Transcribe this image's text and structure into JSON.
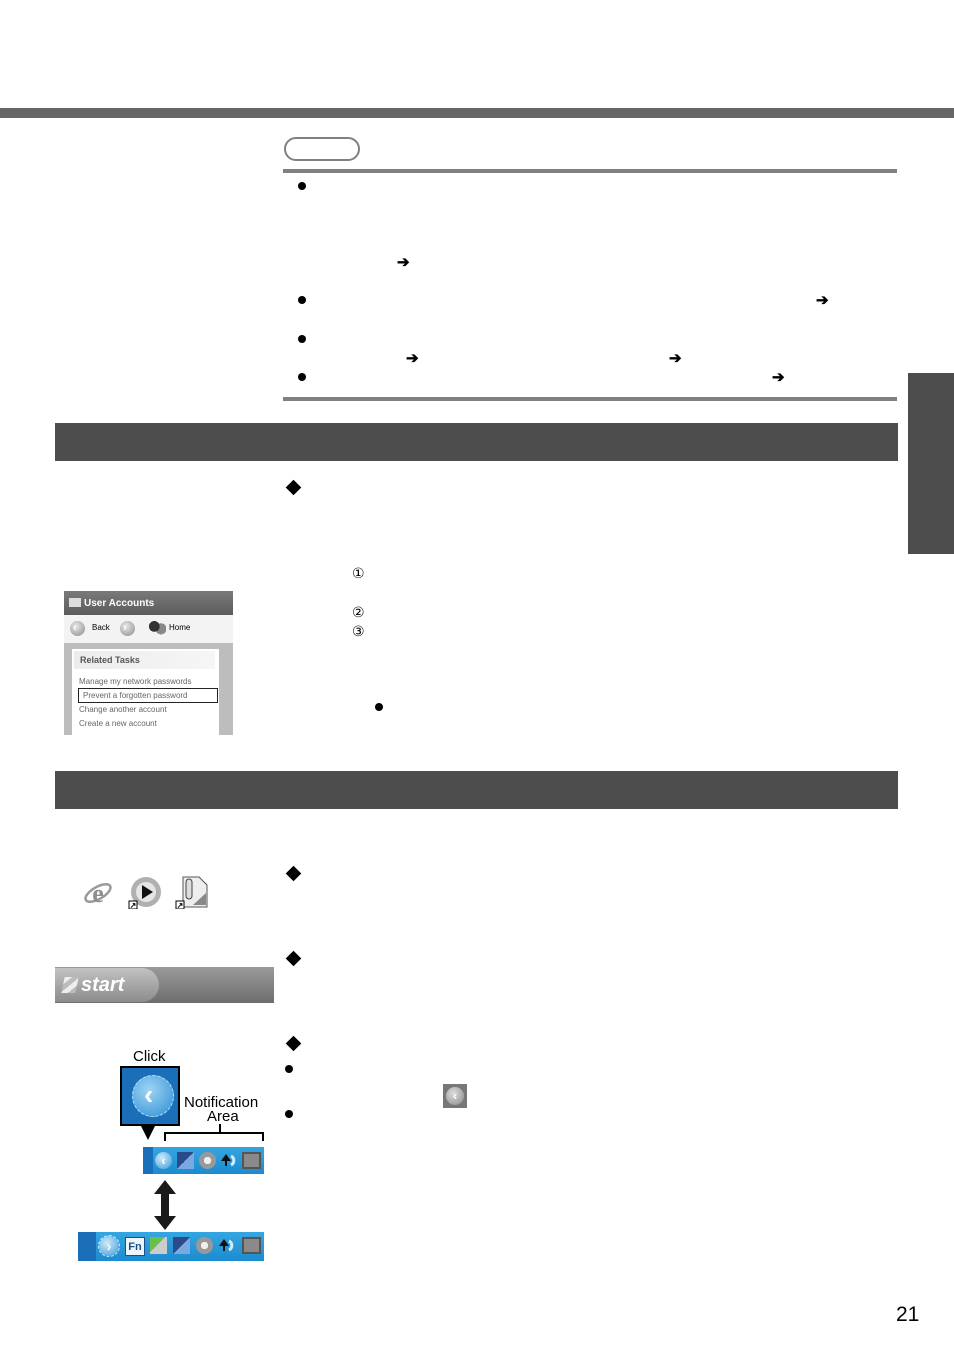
{
  "page": {
    "page_number": "21",
    "colors": {
      "header_rule": "#666666",
      "section_bar": "#4d4d4d",
      "note_rule": "#808080",
      "side_tab": "#4d4d4d",
      "tray_blue": "#1c8bd0"
    }
  },
  "note": {
    "label_icon": "note-pill",
    "bullets": [
      {
        "symbol": "●",
        "arrows": [
          "➔"
        ]
      },
      {
        "symbol": "●",
        "arrows": [
          "➔"
        ]
      },
      {
        "symbol": "●",
        "arrows": [
          "➔",
          "➔"
        ]
      },
      {
        "symbol": "●",
        "arrows": [
          "➔"
        ]
      }
    ]
  },
  "section1": {
    "diamond": "◆",
    "steps": [
      "①",
      "②",
      "③"
    ],
    "bullet": "●",
    "user_accounts": {
      "title": "User Accounts",
      "back_label": "Back",
      "forward_icon": "forward-arrow-icon",
      "home_label": "Home",
      "related_tasks_heading": "Related Tasks",
      "tasks": [
        {
          "label": "Manage my network passwords",
          "selected": false
        },
        {
          "label": "Prevent a forgotten password",
          "selected": true
        },
        {
          "label": "Change another account",
          "selected": false
        },
        {
          "label": "Create a new account",
          "selected": false
        }
      ]
    }
  },
  "section2": {
    "diamonds": [
      "◆",
      "◆",
      "◆"
    ],
    "bullets": [
      "●",
      "●"
    ],
    "desktop_icons": [
      "internet-explorer-icon",
      "media-player-shortcut-icon",
      "volume-document-shortcut-icon"
    ],
    "start_button_label": "start",
    "click_label": "Click",
    "notification_label_line1": "Notification",
    "notification_label_line2": "Area",
    "fn_label": "Fn",
    "expand_glyph": "‹",
    "collapse_glyph": "›"
  }
}
